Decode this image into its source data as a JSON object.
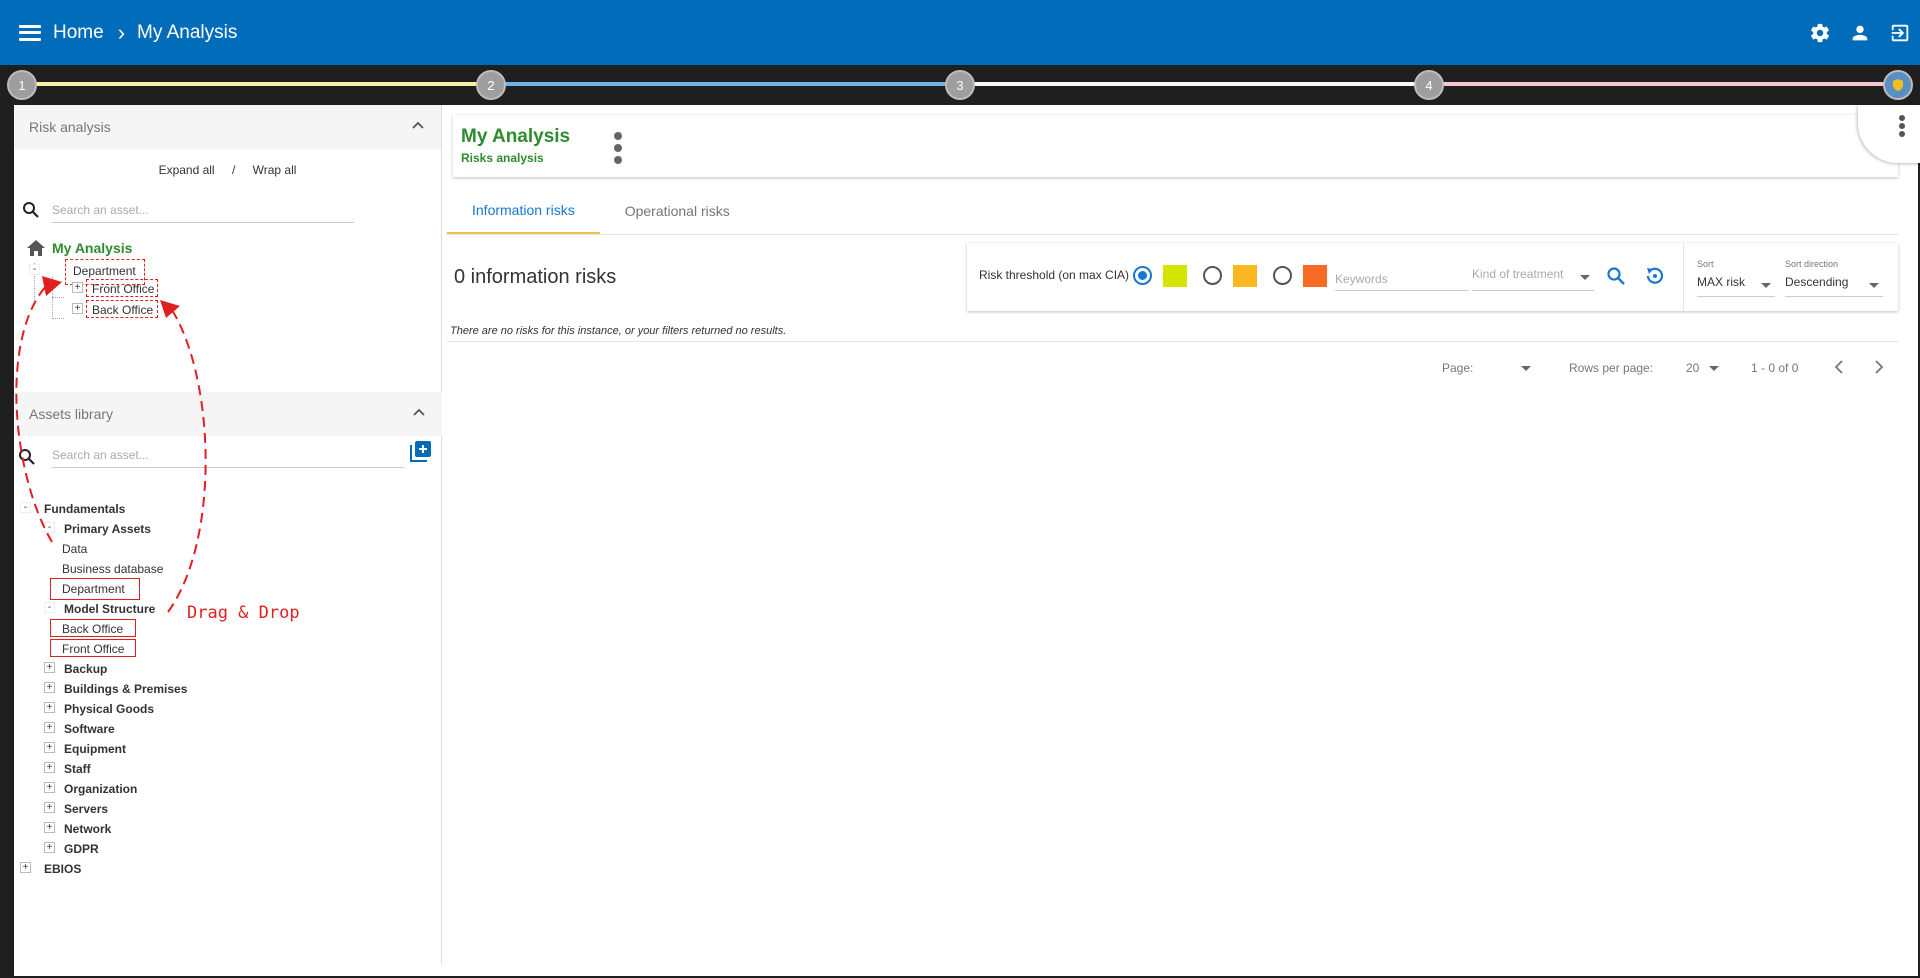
{
  "header": {
    "breadcrumbs": [
      "Home",
      "My Analysis"
    ],
    "icons": [
      "menu-icon",
      "gear-icon",
      "user-icon",
      "logout-icon"
    ]
  },
  "stepper": {
    "steps": [
      "1",
      "2",
      "3",
      "4"
    ],
    "colors": [
      "#f2f2a8",
      "#6fb3e8",
      "#f7f7f7",
      "#f5c8d0"
    ]
  },
  "left": {
    "risk_analysis_title": "Risk analysis",
    "expand_all": "Expand all",
    "separator": "/",
    "wrap_all": "Wrap all",
    "search_placeholder": "Search an asset...",
    "root_label": "My Analysis",
    "tree": {
      "department": "Department",
      "front_office": "Front Office",
      "back_office": "Back Office"
    },
    "library_title": "Assets library",
    "library_search_placeholder": "Search an asset...",
    "library": {
      "fundamentals": "Fundamentals",
      "primary_assets": "Primary Assets",
      "data": "Data",
      "business_database": "Business database",
      "department": "Department",
      "model_structure": "Model Structure",
      "back_office": "Back Office",
      "front_office": "Front Office",
      "groups": [
        "Backup",
        "Buildings & Premises",
        "Physical Goods",
        "Software",
        "Equipment",
        "Staff",
        "Organization",
        "Servers",
        "Network",
        "GDPR"
      ],
      "ebios": "EBIOS"
    },
    "annotation": "Drag & Drop"
  },
  "main": {
    "title": "My Analysis",
    "subtitle": "Risks analysis",
    "tabs": [
      "Information risks",
      "Operational risks"
    ],
    "count_label": "0 information risks",
    "filters": {
      "threshold_label": "Risk threshold (on max CIA)",
      "swatch_colors": [
        "#d4e600",
        "#f9b820",
        "#f76b23"
      ],
      "keywords_placeholder": "Keywords",
      "treatment_placeholder": "Kind of treatment",
      "sort_label": "Sort",
      "sort_value": "MAX risk",
      "direction_label": "Sort direction",
      "direction_value": "Descending"
    },
    "no_results": "There are no risks for this instance, or your filters returned no results.",
    "pager": {
      "page_label": "Page:",
      "rows_label": "Rows per page:",
      "rows_value": "20",
      "range": "1 - 0 of 0"
    }
  }
}
